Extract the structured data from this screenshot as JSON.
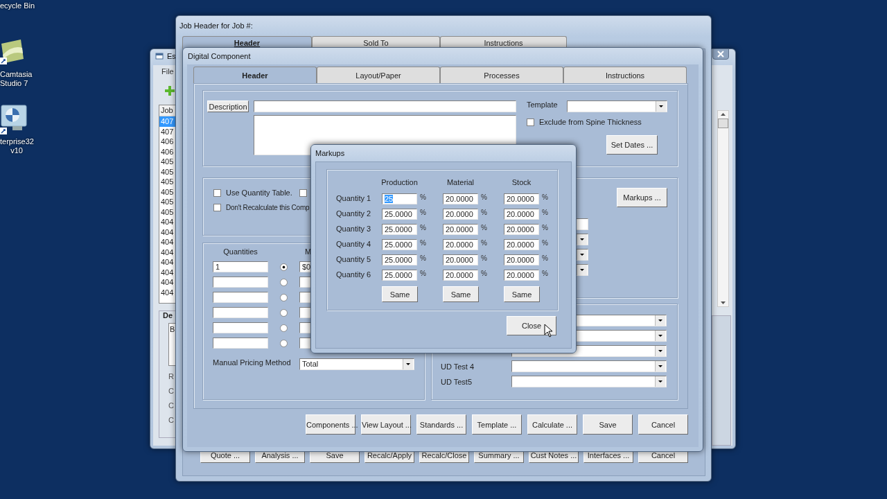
{
  "desktop": {
    "icons": [
      {
        "label": "ecycle Bin",
        "kind": "bin"
      },
      {
        "label": "Camtasia Studio 7",
        "kind": "camtasia"
      },
      {
        "label": "terprise32 v10",
        "kind": "enterprise"
      }
    ]
  },
  "estimate_window": {
    "title": "Es",
    "menu": [
      "File"
    ],
    "list": {
      "header": "Job",
      "rows": [
        {
          "text": "407",
          "selected": true
        },
        {
          "text": "407",
          "selected": false
        },
        {
          "text": "406",
          "selected": false
        },
        {
          "text": "406",
          "selected": false
        },
        {
          "text": "405",
          "selected": false
        },
        {
          "text": "405",
          "selected": false
        },
        {
          "text": "405",
          "selected": false
        },
        {
          "text": "405",
          "selected": false
        },
        {
          "text": "405",
          "selected": false
        },
        {
          "text": "405",
          "selected": false
        },
        {
          "text": "404",
          "selected": false
        },
        {
          "text": "404",
          "selected": false
        },
        {
          "text": "404",
          "selected": false
        },
        {
          "text": "404",
          "selected": false
        },
        {
          "text": "404",
          "selected": false
        },
        {
          "text": "404",
          "selected": false
        },
        {
          "text": "404",
          "selected": false
        },
        {
          "text": "404",
          "selected": false
        }
      ]
    },
    "details": {
      "title": "De",
      "box_text": "B",
      "labels": [
        "R",
        "C",
        "C",
        "C"
      ]
    }
  },
  "job_header": {
    "title": "Job Header for Job #:",
    "tabs": [
      {
        "label": "Header",
        "selected": true
      },
      {
        "label": "Sold To",
        "selected": false
      },
      {
        "label": "Instructions",
        "selected": false
      }
    ],
    "buttons": [
      "Quote ...",
      "Analysis ...",
      "Save",
      "Recalc/Apply",
      "Recalc/Close",
      "Summary ...",
      "Cust Notes ...",
      "Interfaces ...",
      "Cancel"
    ]
  },
  "component": {
    "title": "Digital Component",
    "tabs": [
      {
        "label": "Header",
        "selected": true
      },
      {
        "label": "Layout/Paper",
        "selected": false
      },
      {
        "label": "Processes",
        "selected": false
      },
      {
        "label": "Instructions",
        "selected": false
      }
    ],
    "description_button": "Description",
    "template_label": "Template",
    "exclude": {
      "label": "Exclude from Spine Thickness",
      "checked": false
    },
    "set_dates": "Set Dates ...",
    "options": [
      {
        "label": "Use Quantity Table.",
        "checked": false
      },
      {
        "checked": false
      },
      {
        "label": "Don't Recalculate this Comp",
        "checked": false
      }
    ],
    "markups_button": "Markups ...",
    "hidden_controls": [
      {
        "kind": "input"
      },
      {
        "kind": "select"
      },
      {
        "kind": "select"
      },
      {
        "kind": "select"
      }
    ],
    "quantities": {
      "header": "Quantities",
      "column_2_header": "M",
      "rows": [
        {
          "quantity": "1",
          "column_2": "$0",
          "selected": true
        },
        {
          "selected": false
        },
        {
          "selected": false
        },
        {
          "selected": false
        },
        {
          "selected": false
        },
        {
          "selected": false
        }
      ]
    },
    "pricing_method": {
      "label": "Manual Pricing Method",
      "value": "Total"
    },
    "ud_fields": [
      {
        "kind": "select"
      },
      {
        "kind": "select"
      },
      {
        "kind": "select"
      },
      {
        "kind": "select",
        "label": "UD Test 4"
      },
      {
        "kind": "select",
        "label": "UD Test5"
      }
    ],
    "buttons": [
      "Components ...",
      "View Layout ...",
      "Standards ...",
      "Template ...",
      "Calculate ...",
      "Save",
      "Cancel"
    ]
  },
  "markups": {
    "title": "Markups",
    "columns": [
      "Production",
      "Material",
      "Stock"
    ],
    "rows": [
      {
        "label": "Quantity 1",
        "values": [
          {
            "value": "25",
            "unit": "%",
            "selected": true
          },
          {
            "value": "20.0000",
            "unit": "%",
            "selected": false
          },
          {
            "value": "20.0000",
            "unit": "%",
            "selected": false
          }
        ]
      },
      {
        "label": "Quantity 2",
        "values": [
          {
            "value": "25.0000",
            "unit": "%",
            "selected": false
          },
          {
            "value": "20.0000",
            "unit": "%",
            "selected": false
          },
          {
            "value": "20.0000",
            "unit": "%",
            "selected": false
          }
        ]
      },
      {
        "label": "Quantity 3",
        "values": [
          {
            "value": "25.0000",
            "unit": "%",
            "selected": false
          },
          {
            "value": "20.0000",
            "unit": "%",
            "selected": false
          },
          {
            "value": "20.0000",
            "unit": "%",
            "selected": false
          }
        ]
      },
      {
        "label": "Quantity 4",
        "values": [
          {
            "value": "25.0000",
            "unit": "%",
            "selected": false
          },
          {
            "value": "20.0000",
            "unit": "%",
            "selected": false
          },
          {
            "value": "20.0000",
            "unit": "%",
            "selected": false
          }
        ]
      },
      {
        "label": "Quantity 5",
        "values": [
          {
            "value": "25.0000",
            "unit": "%",
            "selected": false
          },
          {
            "value": "20.0000",
            "unit": "%",
            "selected": false
          },
          {
            "value": "20.0000",
            "unit": "%",
            "selected": false
          }
        ]
      },
      {
        "label": "Quantity 6",
        "values": [
          {
            "value": "25.0000",
            "unit": "%",
            "selected": false
          },
          {
            "value": "20.0000",
            "unit": "%",
            "selected": false
          },
          {
            "value": "20.0000",
            "unit": "%",
            "selected": false
          }
        ]
      }
    ],
    "same_buttons": [
      "Same",
      "Same",
      "Same"
    ],
    "close": "Close"
  }
}
